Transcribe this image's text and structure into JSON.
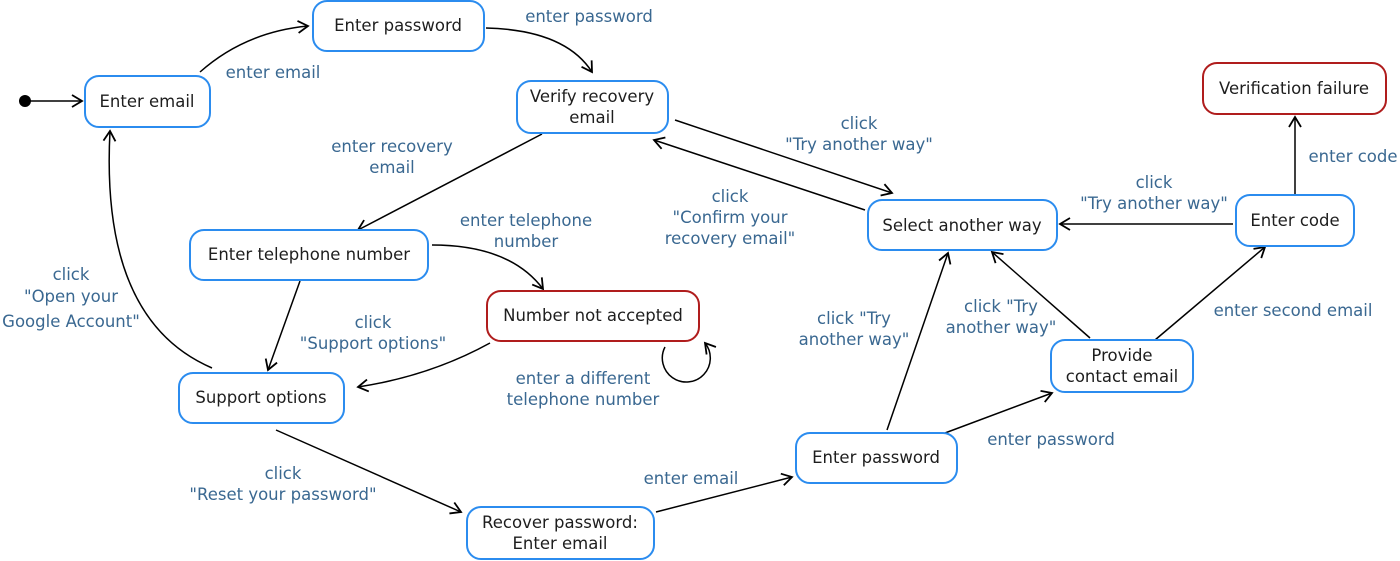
{
  "colors": {
    "state_border": "#2b8cef",
    "error_border": "#b01d1d",
    "label_text": "#3a6891",
    "arrow": "#000000"
  },
  "states": {
    "enter_email": "Enter email",
    "enter_password_top": "Enter password",
    "verify_recovery": [
      "Verify recovery",
      "email"
    ],
    "select_another_way": "Select another way",
    "verification_failure": "Verification failure",
    "enter_code": "Enter code",
    "enter_telephone": "Enter telephone number",
    "number_not_accepted": "Number not accepted",
    "support_options": "Support options",
    "recover_password": [
      "Recover password:",
      "Enter email"
    ],
    "enter_password_bottom": "Enter password",
    "provide_contact_email": [
      "Provide",
      "contact email"
    ]
  },
  "transitions": {
    "t_enter_email": [
      "enter email"
    ],
    "t_enter_password": [
      "enter password"
    ],
    "t_enter_recovery_email": [
      "enter recovery",
      "email"
    ],
    "t_try_another_way_1": [
      "click",
      "\"Try another way\""
    ],
    "t_confirm_recovery": [
      "click",
      "\"Confirm your",
      "recovery email\""
    ],
    "t_enter_telephone": [
      "enter telephone",
      "number"
    ],
    "t_support_options": [
      "click",
      "\"Support options\""
    ],
    "t_different_number": [
      "enter a different",
      "telephone number"
    ],
    "t_open_google_account": [
      "click",
      "\"Open your",
      "Google Account\""
    ],
    "t_reset_password": [
      "click",
      "\"Reset your password\""
    ],
    "t_recover_enter_email": [
      "enter email"
    ],
    "t_try_another_way_2": [
      "click \"Try",
      "another way\""
    ],
    "t_enter_password_2": [
      "enter password"
    ],
    "t_try_another_way_3": [
      "click \"Try",
      "another way\""
    ],
    "t_enter_second_email": [
      "enter second email"
    ],
    "t_try_another_way_4": [
      "click",
      "\"Try another way\""
    ],
    "t_enter_code": [
      "enter code"
    ]
  }
}
